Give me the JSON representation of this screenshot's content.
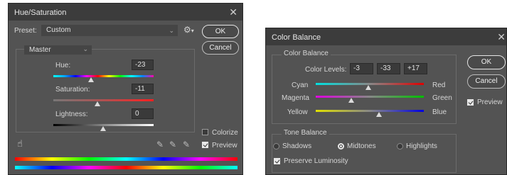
{
  "hue_saturation": {
    "title": "Hue/Saturation",
    "preset_label": "Preset:",
    "preset_value": "Custom",
    "ok": "OK",
    "cancel": "Cancel",
    "channel": "Master",
    "hue_label": "Hue:",
    "hue_value": "-23",
    "saturation_label": "Saturation:",
    "saturation_value": "-11",
    "lightness_label": "Lightness:",
    "lightness_value": "0",
    "colorize_label": "Colorize",
    "colorize_checked": false,
    "preview_label": "Preview",
    "preview_checked": true
  },
  "color_balance": {
    "title": "Color Balance",
    "section_color_balance": "Color Balance",
    "color_levels_label": "Color Levels:",
    "levels": [
      "-3",
      "-33",
      "+17"
    ],
    "cyan": "Cyan",
    "red": "Red",
    "magenta": "Magenta",
    "green": "Green",
    "yellow": "Yellow",
    "blue": "Blue",
    "section_tone_balance": "Tone Balance",
    "shadows": "Shadows",
    "midtones": "Midtones",
    "highlights": "Highlights",
    "selected_tone": "Midtones",
    "preserve_luminosity": "Preserve Luminosity",
    "preserve_checked": true,
    "ok": "OK",
    "cancel": "Cancel",
    "preview_label": "Preview",
    "preview_checked": true
  },
  "icons": {
    "close": "close-icon",
    "gear": "gear-icon",
    "hand": "hand-adjust-icon",
    "eyedroppers": [
      "eyedropper-icon",
      "eyedropper-plus-icon",
      "eyedropper-minus-icon"
    ]
  }
}
